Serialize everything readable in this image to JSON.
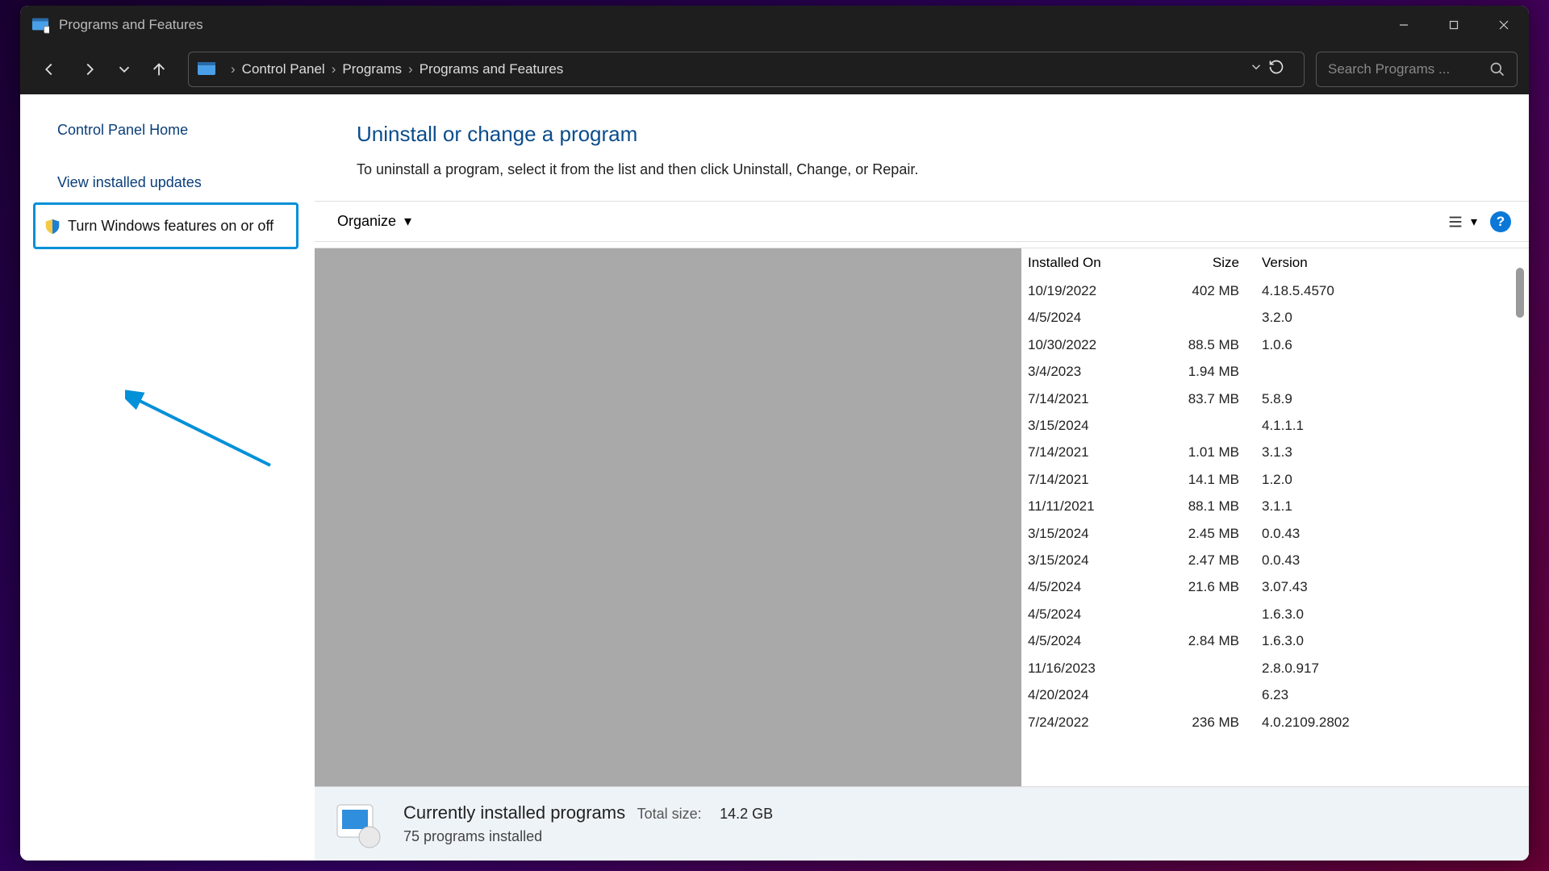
{
  "window": {
    "title": "Programs and Features"
  },
  "breadcrumb": {
    "root": "Control Panel",
    "mid": "Programs",
    "leaf": "Programs and Features"
  },
  "search": {
    "placeholder": "Search Programs ..."
  },
  "sidebar": {
    "home": "Control Panel Home",
    "updates": "View installed updates",
    "features": "Turn Windows features on or off"
  },
  "main": {
    "heading": "Uninstall or change a program",
    "subtext": "To uninstall a program, select it from the list and then click Uninstall, Change, or Repair.",
    "organize": "Organize"
  },
  "columns": {
    "date": "Installed On",
    "size": "Size",
    "version": "Version"
  },
  "rows": [
    {
      "date": "10/19/2022",
      "size": "402 MB",
      "version": "4.18.5.4570"
    },
    {
      "date": "4/5/2024",
      "size": "",
      "version": "3.2.0"
    },
    {
      "date": "10/30/2022",
      "size": "88.5 MB",
      "version": "1.0.6"
    },
    {
      "date": "3/4/2023",
      "size": "1.94 MB",
      "version": ""
    },
    {
      "date": "7/14/2021",
      "size": "83.7 MB",
      "version": "5.8.9"
    },
    {
      "date": "3/15/2024",
      "size": "",
      "version": "4.1.1.1"
    },
    {
      "date": "7/14/2021",
      "size": "1.01 MB",
      "version": "3.1.3"
    },
    {
      "date": "7/14/2021",
      "size": "14.1 MB",
      "version": "1.2.0"
    },
    {
      "date": "11/11/2021",
      "size": "88.1 MB",
      "version": "3.1.1"
    },
    {
      "date": "3/15/2024",
      "size": "2.45 MB",
      "version": "0.0.43"
    },
    {
      "date": "3/15/2024",
      "size": "2.47 MB",
      "version": "0.0.43"
    },
    {
      "date": "4/5/2024",
      "size": "21.6 MB",
      "version": "3.07.43"
    },
    {
      "date": "4/5/2024",
      "size": "",
      "version": "1.6.3.0"
    },
    {
      "date": "4/5/2024",
      "size": "2.84 MB",
      "version": "1.6.3.0"
    },
    {
      "date": "11/16/2023",
      "size": "",
      "version": "2.8.0.917"
    },
    {
      "date": "4/20/2024",
      "size": "",
      "version": "6.23"
    },
    {
      "date": "7/24/2022",
      "size": "236 MB",
      "version": "4.0.2109.2802"
    }
  ],
  "status": {
    "title": "Currently installed programs",
    "totals_label": "Total size:",
    "totals_value": "14.2 GB",
    "count": "75 programs installed"
  }
}
